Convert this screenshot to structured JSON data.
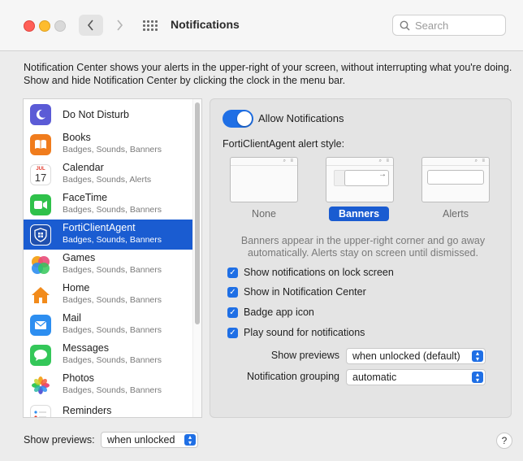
{
  "window": {
    "title": "Notifications",
    "search_placeholder": "Search"
  },
  "description": "Notification Center shows your alerts in the upper-right of your screen, without interrupting what you're doing. Show and hide Notification Center by clicking the clock in the menu bar.",
  "apps": [
    {
      "name": "Do Not Disturb",
      "sub": "",
      "icon": "moon-icon",
      "color": "#5b5bd6"
    },
    {
      "name": "Books",
      "sub": "Badges, Sounds, Banners",
      "icon": "books-icon",
      "color": "#f07c1d"
    },
    {
      "name": "Calendar",
      "sub": "Badges, Sounds, Alerts",
      "icon": "calendar-icon",
      "color": "#ffffff",
      "month": "JUL",
      "day": "17"
    },
    {
      "name": "FaceTime",
      "sub": "Badges, Sounds, Banners",
      "icon": "facetime-icon",
      "color": "#2fc14a"
    },
    {
      "name": "FortiClientAgent",
      "sub": "Badges, Sounds, Banners",
      "icon": "forticlient-icon",
      "color": "#1f4fae",
      "selected": true
    },
    {
      "name": "Games",
      "sub": "Badges, Sounds, Banners",
      "icon": "games-icon",
      "color": "#e84b7a"
    },
    {
      "name": "Home",
      "sub": "Badges, Sounds, Banners",
      "icon": "home-icon",
      "color": "#f28b1b"
    },
    {
      "name": "Mail",
      "sub": "Badges, Sounds, Banners",
      "icon": "mail-icon",
      "color": "#2d8ef0"
    },
    {
      "name": "Messages",
      "sub": "Badges, Sounds, Banners",
      "icon": "messages-icon",
      "color": "#34c759"
    },
    {
      "name": "Photos",
      "sub": "Badges, Sounds, Banners",
      "icon": "photos-icon",
      "color": "#ffffff"
    },
    {
      "name": "Reminders",
      "sub": "",
      "icon": "reminders-icon",
      "color": "#ffffff"
    }
  ],
  "detail": {
    "allow_label": "Allow Notifications",
    "allow_enabled": true,
    "style_label": "FortiClientAgent alert style:",
    "styles": [
      "None",
      "Banners",
      "Alerts"
    ],
    "selected_style": "Banners",
    "hint": "Banners appear in the upper-right corner and go away automatically. Alerts stay on screen until dismissed.",
    "checks": [
      {
        "label": "Show notifications on lock screen",
        "checked": true
      },
      {
        "label": "Show in Notification Center",
        "checked": true
      },
      {
        "label": "Badge app icon",
        "checked": true
      },
      {
        "label": "Play sound for notifications",
        "checked": true
      }
    ],
    "show_previews_label": "Show previews",
    "show_previews_value": "when unlocked (default)",
    "grouping_label": "Notification grouping",
    "grouping_value": "automatic"
  },
  "bottom": {
    "show_previews_label": "Show previews:",
    "show_previews_value": "when unlocked",
    "help": "?"
  },
  "colors": {
    "accent": "#1f6fe5",
    "selection": "#1a5cd1"
  }
}
